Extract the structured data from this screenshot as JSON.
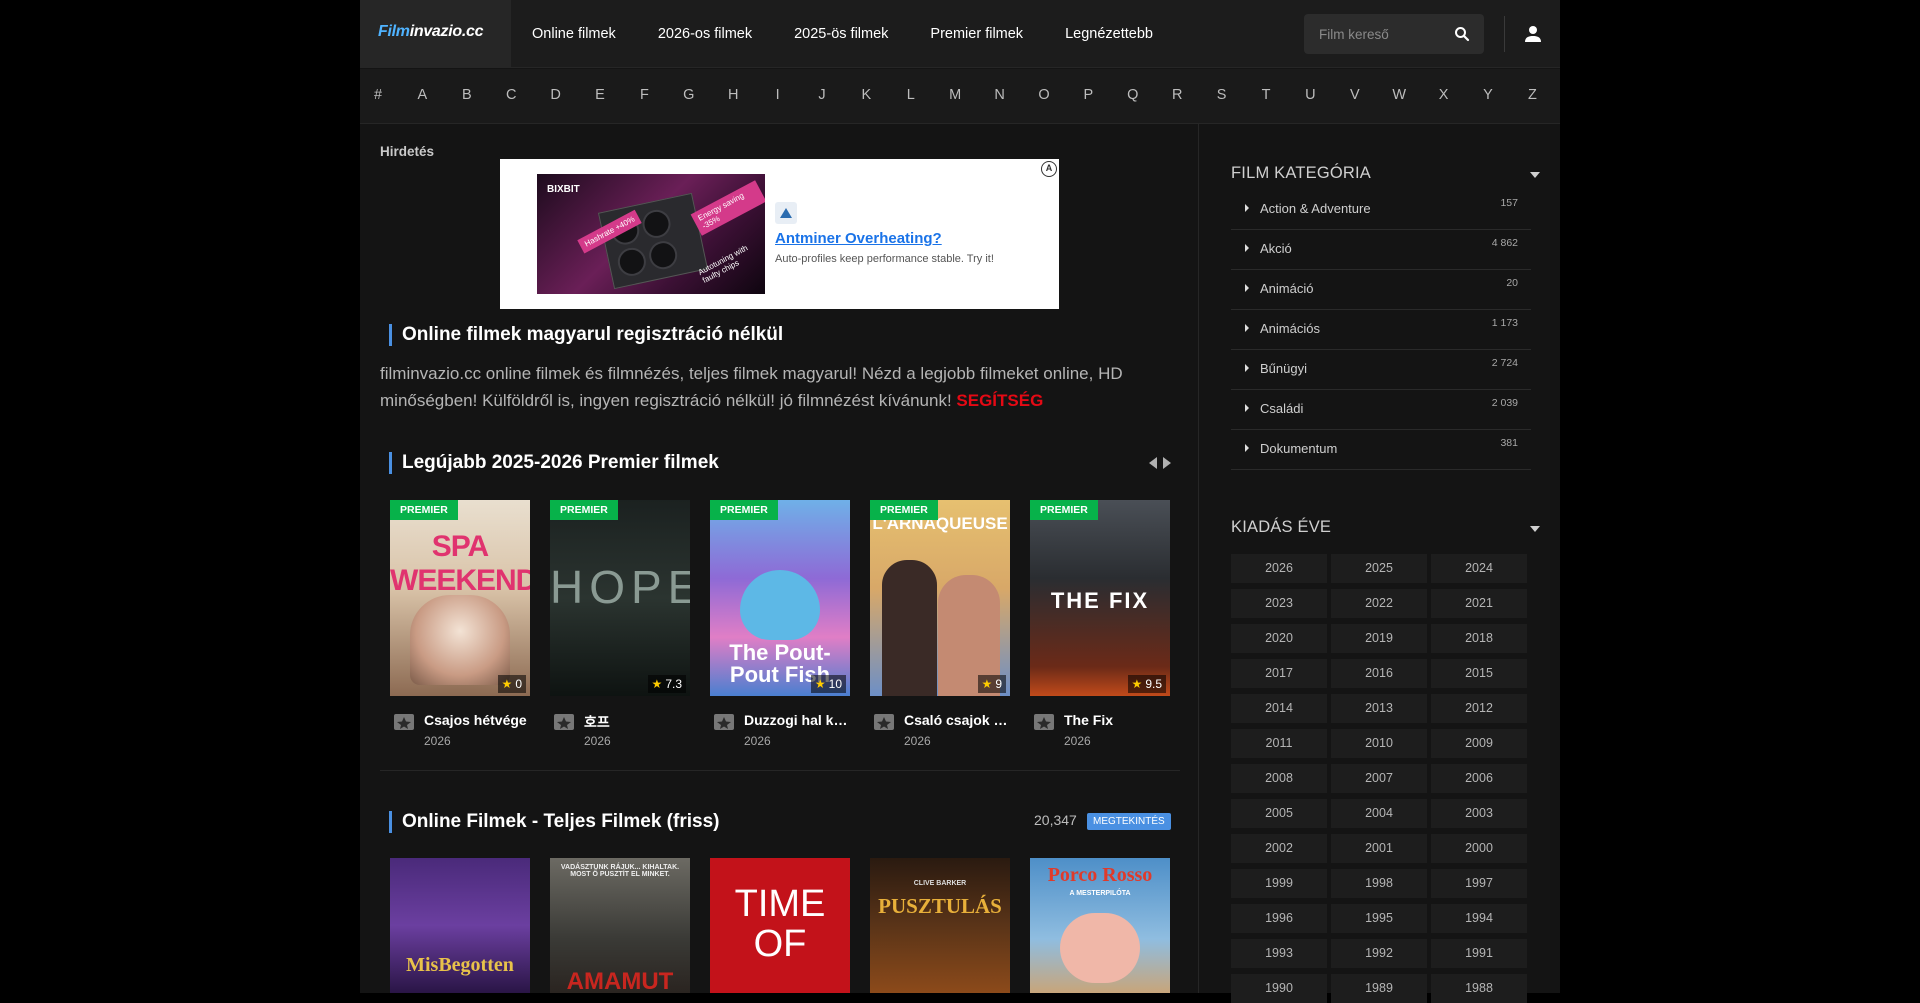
{
  "header": {
    "logo_part1": "Film",
    "logo_part2": "invazio.cc",
    "nav": [
      "Online filmek",
      "2026-os filmek",
      "2025-ös filmek",
      "Premier filmek",
      "Legnézettebb"
    ],
    "search_placeholder": "Film kereső"
  },
  "alphabet": [
    "#",
    "A",
    "B",
    "C",
    "D",
    "E",
    "F",
    "G",
    "H",
    "I",
    "J",
    "K",
    "L",
    "M",
    "N",
    "O",
    "P",
    "Q",
    "R",
    "S",
    "T",
    "U",
    "V",
    "W",
    "X",
    "Y",
    "Z"
  ],
  "ad": {
    "label": "Hirdetés",
    "brand": "BIXBIT",
    "tag1": "Hashrate +40%",
    "tag2": "Energy saving -35%",
    "tag3": "Autotuning with faulty chips",
    "title": "Antminer Overheating?",
    "subtitle": "Auto-profiles keep performance stable. Try it!"
  },
  "intro": {
    "title": "Online filmek magyarul regisztráció nélkül",
    "text": "filminvazio.cc online filmek és filmnézés, teljes filmek magyarul! Nézd a legjobb filmeket online, HD minőségben! Külföldről is, ingyen regisztráció nélkül! jó filmnézést kívánunk! ",
    "help": "SEGÍTSÉG"
  },
  "premier": {
    "title": "Legújabb 2025-2026 Premier filmek",
    "badge": "PREMIER",
    "movies": [
      {
        "title": "Csajos hétvége",
        "year": "2026",
        "rating": "0",
        "poster_text": "SPA WEEKEND"
      },
      {
        "title": "호프",
        "year": "2026",
        "rating": "7.3",
        "poster_text": "HOPE"
      },
      {
        "title": "Duzzogi hal kal...",
        "year": "2026",
        "rating": "10",
        "poster_text": "The Pout-Pout Fish"
      },
      {
        "title": "Csaló csajok P...",
        "year": "2026",
        "rating": "9",
        "poster_text": "L'ARNAQUEUSE"
      },
      {
        "title": "The Fix",
        "year": "2026",
        "rating": "9.5",
        "poster_text": "THE FIX"
      }
    ]
  },
  "online": {
    "title": "Online Filmek - Teljes Filmek (friss)",
    "count": "20,347",
    "view_button": "MEGTEKINTÉS",
    "posters": [
      {
        "text": "MisBegotten"
      },
      {
        "text": "VADÁSZTUNK RÁJUK... KIHALTAK. MOST Ő PUSZTÍT EL MINKET.",
        "text2": "AMAMUT"
      },
      {
        "text": "TIME OF"
      },
      {
        "text": "CLIVE BARKER",
        "text2": "PUSZTULÁS"
      },
      {
        "text": "Porco Rosso",
        "text2": "A MESTERPILÓTA"
      }
    ]
  },
  "sidebar": {
    "category_title": "FILM KATEGÓRIA",
    "categories": [
      {
        "name": "Action & Adventure",
        "count": "157"
      },
      {
        "name": "Akció",
        "count": "4 862"
      },
      {
        "name": "Animáció",
        "count": "20"
      },
      {
        "name": "Animációs",
        "count": "1 173"
      },
      {
        "name": "Bűnügyi",
        "count": "2 724"
      },
      {
        "name": "Családi",
        "count": "2 039"
      },
      {
        "name": "Dokumentum",
        "count": "381"
      }
    ],
    "year_title": "KIADÁS ÉVE",
    "years": [
      "2026",
      "2025",
      "2024",
      "2023",
      "2022",
      "2021",
      "2020",
      "2019",
      "2018",
      "2017",
      "2016",
      "2015",
      "2014",
      "2013",
      "2012",
      "2011",
      "2010",
      "2009",
      "2008",
      "2007",
      "2006",
      "2005",
      "2004",
      "2003",
      "2002",
      "2001",
      "2000",
      "1999",
      "1998",
      "1997",
      "1996",
      "1995",
      "1994",
      "1993",
      "1992",
      "1991",
      "1990",
      "1989",
      "1988"
    ]
  }
}
